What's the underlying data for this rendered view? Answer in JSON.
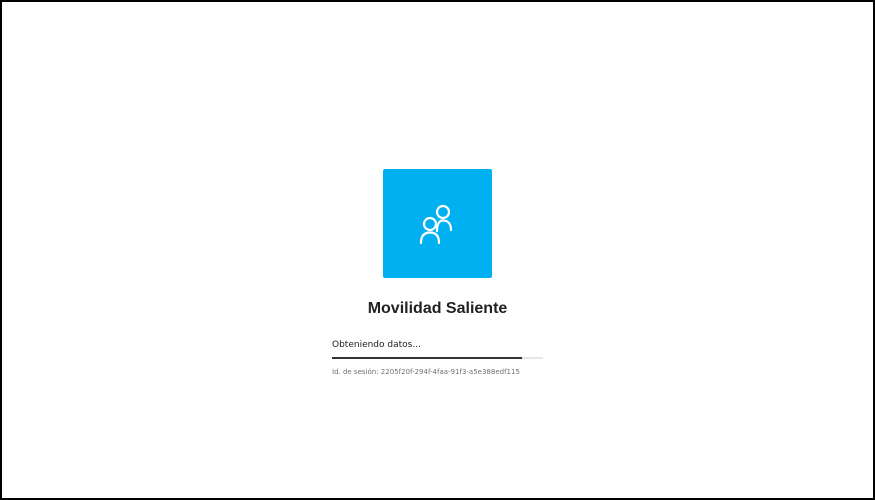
{
  "app": {
    "title": "Movilidad Saliente",
    "tile_color": "#00b0f0",
    "icon": "people-icon"
  },
  "loading": {
    "text": "Obteniendo datos...",
    "progress_fraction": 0.9
  },
  "session": {
    "label": "Id. de sesión:",
    "id": "2205f20f-294f-4faa-91f3-a5e388edf115"
  }
}
